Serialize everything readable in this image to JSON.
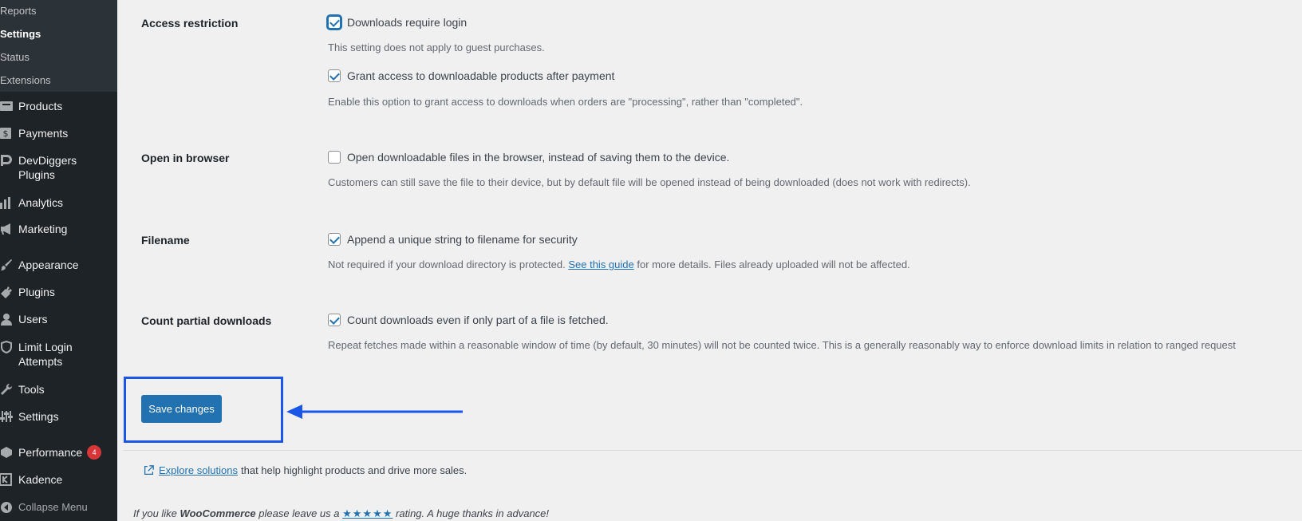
{
  "sidebar": {
    "submenu": [
      "Reports",
      "Settings",
      "Status",
      "Extensions"
    ],
    "items": [
      {
        "label": "Products",
        "icon": "archive-icon"
      },
      {
        "label": "Payments",
        "icon": "dollar-icon"
      },
      {
        "label": "DevDiggers Plugins",
        "icon": "devdiggers-icon"
      },
      {
        "label": "Analytics",
        "icon": "bar-chart-icon"
      },
      {
        "label": "Marketing",
        "icon": "megaphone-icon"
      },
      {
        "label": "Appearance",
        "icon": "paintbrush-icon"
      },
      {
        "label": "Plugins",
        "icon": "plug-icon"
      },
      {
        "label": "Users",
        "icon": "user-icon"
      },
      {
        "label": "Limit Login Attempts",
        "icon": "shield-icon"
      },
      {
        "label": "Tools",
        "icon": "wrench-icon"
      },
      {
        "label": "Settings",
        "icon": "sliders-icon"
      },
      {
        "label": "Performance",
        "icon": "performance-icon",
        "badge": "4"
      },
      {
        "label": "Kadence",
        "icon": "kadence-icon"
      }
    ],
    "collapse": "Collapse Menu"
  },
  "settings": {
    "access": {
      "label": "Access restriction",
      "opt1": "Downloads require login",
      "desc1": "This setting does not apply to guest purchases.",
      "opt2": "Grant access to downloadable products after payment",
      "desc2": "Enable this option to grant access to downloads when orders are \"processing\", rather than \"completed\"."
    },
    "browser": {
      "label": "Open in browser",
      "opt": "Open downloadable files in the browser, instead of saving them to the device.",
      "desc": "Customers can still save the file to their device, but by default file will be opened instead of being downloaded (does not work with redirects)."
    },
    "filename": {
      "label": "Filename",
      "opt": "Append a unique string to filename for security",
      "desc_before": "Not required if your download directory is protected.",
      "desc_link": "See this guide",
      "desc_after": "for more details. Files already uploaded will not be affected."
    },
    "partial": {
      "label": "Count partial downloads",
      "opt": "Count downloads even if only part of a file is fetched.",
      "desc": "Repeat fetches made within a reasonable window of time (by default, 30 minutes) will not be counted twice. This is a generally reasonably way to enforce download limits in relation to ranged request"
    },
    "save_label": "Save changes"
  },
  "explore": {
    "link": "Explore solutions",
    "text": "that help highlight products and drive more sales."
  },
  "footer": {
    "before": "If you like",
    "brand": "WooCommerce",
    "middle": "please leave us a",
    "stars": "★★★★★",
    "after": "rating. A huge thanks in advance!"
  },
  "colors": {
    "accent": "#2271b1",
    "highlight": "#1a56e8",
    "sidebar": "#1d2327"
  }
}
